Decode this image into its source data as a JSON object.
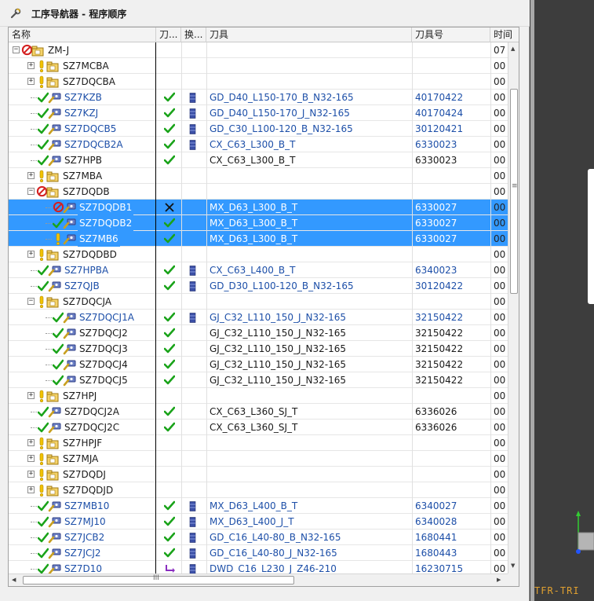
{
  "panel": {
    "title": "工序导航器 - 程序顺序",
    "title_icon": "wrench-icon"
  },
  "columns": {
    "name": "名称",
    "generated": "刀...",
    "changed": "换...",
    "tool": "刀具",
    "tool_number": "刀具号",
    "time": "时间"
  },
  "colors": {
    "selection": "#3399ff",
    "link_blue": "#1d4fa8",
    "check_green": "#1aa31a",
    "warning_yellow": "#f2c200",
    "prohibit_red": "#d42020",
    "viewport_bg": "#3d3d3d",
    "viewport_label": "#e0a030"
  },
  "rows": [
    {
      "name": "ZM-J",
      "level": 0,
      "expander": "-",
      "status": "prohibit",
      "kind": "group",
      "gen": "",
      "chg": "",
      "tool": "",
      "tool_no": "",
      "time": "07",
      "blue": false,
      "selected": false
    },
    {
      "name": "SZ7MCBA",
      "level": 1,
      "expander": "+",
      "status": "warn",
      "kind": "group",
      "gen": "",
      "chg": "",
      "tool": "",
      "tool_no": "",
      "time": "00",
      "blue": false,
      "selected": false
    },
    {
      "name": "SZ7DQCBA",
      "level": 1,
      "expander": "+",
      "status": "warn",
      "kind": "group",
      "gen": "",
      "chg": "",
      "tool": "",
      "tool_no": "",
      "time": "00",
      "blue": false,
      "selected": false
    },
    {
      "name": "SZ7KZB",
      "level": 1,
      "expander": "",
      "status": "ok",
      "kind": "op",
      "gen": "check",
      "chg": "tool",
      "tool": "GD_D40_L150-170_B_N32-165",
      "tool_no": "40170422",
      "time": "00",
      "blue": true,
      "selected": false
    },
    {
      "name": "SZ7KZJ",
      "level": 1,
      "expander": "",
      "status": "ok",
      "kind": "op",
      "gen": "check",
      "chg": "tool",
      "tool": "GD_D40_L150-170_J_N32-165",
      "tool_no": "40170424",
      "time": "00",
      "blue": true,
      "selected": false
    },
    {
      "name": "SZ7DQCB5",
      "level": 1,
      "expander": "",
      "status": "ok",
      "kind": "op",
      "gen": "check",
      "chg": "tool",
      "tool": "GD_C30_L100-120_B_N32-165",
      "tool_no": "30120421",
      "time": "00",
      "blue": true,
      "selected": false
    },
    {
      "name": "SZ7DQCB2A",
      "level": 1,
      "expander": "",
      "status": "ok",
      "kind": "op",
      "gen": "check",
      "chg": "tool",
      "tool": "CX_C63_L300_B_T",
      "tool_no": "6330023",
      "time": "00",
      "blue": true,
      "selected": false
    },
    {
      "name": "SZ7HPB",
      "level": 1,
      "expander": "",
      "status": "ok",
      "kind": "op",
      "gen": "check",
      "chg": "",
      "tool": "CX_C63_L300_B_T",
      "tool_no": "6330023",
      "time": "00",
      "blue": false,
      "selected": false
    },
    {
      "name": "SZ7MBA",
      "level": 1,
      "expander": "+",
      "status": "warn",
      "kind": "group",
      "gen": "",
      "chg": "",
      "tool": "",
      "tool_no": "",
      "time": "00",
      "blue": false,
      "selected": false
    },
    {
      "name": "SZ7DQDB",
      "level": 1,
      "expander": "-",
      "status": "prohibit",
      "kind": "group",
      "gen": "",
      "chg": "",
      "tool": "",
      "tool_no": "",
      "time": "00",
      "blue": false,
      "selected": false
    },
    {
      "name": "SZ7DQDB1",
      "level": 2,
      "expander": "",
      "status": "prohibit",
      "kind": "op",
      "gen": "cross",
      "chg": "",
      "tool": "MX_D63_L300_B_T",
      "tool_no": "6330027",
      "time": "00",
      "blue": false,
      "selected": true
    },
    {
      "name": "SZ7DQDB2",
      "level": 2,
      "expander": "",
      "status": "ok",
      "kind": "op",
      "gen": "check",
      "chg": "",
      "tool": "MX_D63_L300_B_T",
      "tool_no": "6330027",
      "time": "00",
      "blue": false,
      "selected": true
    },
    {
      "name": "SZ7MB6",
      "level": 2,
      "expander": "",
      "status": "warn",
      "kind": "op",
      "gen": "check",
      "chg": "",
      "tool": "MX_D63_L300_B_T",
      "tool_no": "6330027",
      "time": "00",
      "blue": false,
      "selected": true
    },
    {
      "name": "SZ7DQDBD",
      "level": 1,
      "expander": "+",
      "status": "warn",
      "kind": "group",
      "gen": "",
      "chg": "",
      "tool": "",
      "tool_no": "",
      "time": "00",
      "blue": false,
      "selected": false
    },
    {
      "name": "SZ7HPBA",
      "level": 1,
      "expander": "",
      "status": "ok",
      "kind": "op",
      "gen": "check",
      "chg": "tool",
      "tool": "CX_C63_L400_B_T",
      "tool_no": "6340023",
      "time": "00",
      "blue": true,
      "selected": false
    },
    {
      "name": "SZ7QJB",
      "level": 1,
      "expander": "",
      "status": "ok",
      "kind": "op",
      "gen": "check",
      "chg": "tool",
      "tool": "GD_D30_L100-120_B_N32-165",
      "tool_no": "30120422",
      "time": "00",
      "blue": true,
      "selected": false
    },
    {
      "name": "SZ7DQCJA",
      "level": 1,
      "expander": "-",
      "status": "warn",
      "kind": "group",
      "gen": "",
      "chg": "",
      "tool": "",
      "tool_no": "",
      "time": "00",
      "blue": false,
      "selected": false
    },
    {
      "name": "SZ7DQCJ1A",
      "level": 2,
      "expander": "",
      "status": "ok",
      "kind": "op",
      "gen": "check",
      "chg": "tool",
      "tool": "GJ_C32_L110_150_J_N32-165",
      "tool_no": "32150422",
      "time": "00",
      "blue": true,
      "selected": false
    },
    {
      "name": "SZ7DQCJ2",
      "level": 2,
      "expander": "",
      "status": "ok",
      "kind": "op",
      "gen": "check",
      "chg": "",
      "tool": "GJ_C32_L110_150_J_N32-165",
      "tool_no": "32150422",
      "time": "00",
      "blue": false,
      "selected": false
    },
    {
      "name": "SZ7DQCJ3",
      "level": 2,
      "expander": "",
      "status": "ok",
      "kind": "op",
      "gen": "check",
      "chg": "",
      "tool": "GJ_C32_L110_150_J_N32-165",
      "tool_no": "32150422",
      "time": "00",
      "blue": false,
      "selected": false
    },
    {
      "name": "SZ7DQCJ4",
      "level": 2,
      "expander": "",
      "status": "ok",
      "kind": "op",
      "gen": "check",
      "chg": "",
      "tool": "GJ_C32_L110_150_J_N32-165",
      "tool_no": "32150422",
      "time": "00",
      "blue": false,
      "selected": false
    },
    {
      "name": "SZ7DQCJ5",
      "level": 2,
      "expander": "",
      "status": "ok",
      "kind": "op",
      "gen": "check",
      "chg": "",
      "tool": "GJ_C32_L110_150_J_N32-165",
      "tool_no": "32150422",
      "time": "00",
      "blue": false,
      "selected": false
    },
    {
      "name": "SZ7HPJ",
      "level": 1,
      "expander": "+",
      "status": "warn",
      "kind": "group",
      "gen": "",
      "chg": "",
      "tool": "",
      "tool_no": "",
      "time": "00",
      "blue": false,
      "selected": false
    },
    {
      "name": "SZ7DQCJ2A",
      "level": 1,
      "expander": "",
      "status": "ok",
      "kind": "op",
      "gen": "check",
      "chg": "",
      "tool": "CX_C63_L360_SJ_T",
      "tool_no": "6336026",
      "time": "00",
      "blue": false,
      "selected": false
    },
    {
      "name": "SZ7DQCJ2C",
      "level": 1,
      "expander": "",
      "status": "ok",
      "kind": "op",
      "gen": "check",
      "chg": "",
      "tool": "CX_C63_L360_SJ_T",
      "tool_no": "6336026",
      "time": "00",
      "blue": false,
      "selected": false
    },
    {
      "name": "SZ7HPJF",
      "level": 1,
      "expander": "+",
      "status": "warn",
      "kind": "group",
      "gen": "",
      "chg": "",
      "tool": "",
      "tool_no": "",
      "time": "00",
      "blue": false,
      "selected": false
    },
    {
      "name": "SZ7MJA",
      "level": 1,
      "expander": "+",
      "status": "warn",
      "kind": "group",
      "gen": "",
      "chg": "",
      "tool": "",
      "tool_no": "",
      "time": "00",
      "blue": false,
      "selected": false
    },
    {
      "name": "SZ7DQDJ",
      "level": 1,
      "expander": "+",
      "status": "warn",
      "kind": "group",
      "gen": "",
      "chg": "",
      "tool": "",
      "tool_no": "",
      "time": "00",
      "blue": false,
      "selected": false
    },
    {
      "name": "SZ7DQDJD",
      "level": 1,
      "expander": "+",
      "status": "warn",
      "kind": "group",
      "gen": "",
      "chg": "",
      "tool": "",
      "tool_no": "",
      "time": "00",
      "blue": false,
      "selected": false
    },
    {
      "name": "SZ7MB10",
      "level": 1,
      "expander": "",
      "status": "ok",
      "kind": "op",
      "gen": "check",
      "chg": "tool",
      "tool": "MX_D63_L400_B_T",
      "tool_no": "6340027",
      "time": "00",
      "blue": true,
      "selected": false
    },
    {
      "name": "SZ7MJ10",
      "level": 1,
      "expander": "",
      "status": "ok",
      "kind": "op",
      "gen": "check",
      "chg": "tool",
      "tool": "MX_D63_L400_J_T",
      "tool_no": "6340028",
      "time": "00",
      "blue": true,
      "selected": false
    },
    {
      "name": "SZ7JCB2",
      "level": 1,
      "expander": "",
      "status": "ok",
      "kind": "op",
      "gen": "check",
      "chg": "tool",
      "tool": "GD_C16_L40-80_B_N32-165",
      "tool_no": "1680441",
      "time": "00",
      "blue": true,
      "selected": false
    },
    {
      "name": "SZ7JCJ2",
      "level": 1,
      "expander": "",
      "status": "ok",
      "kind": "op",
      "gen": "check",
      "chg": "tool",
      "tool": "GD_C16_L40-80_J_N32-165",
      "tool_no": "1680443",
      "time": "00",
      "blue": true,
      "selected": false
    },
    {
      "name": "SZ7D10",
      "level": 1,
      "expander": "",
      "status": "ok",
      "kind": "op",
      "gen": "arrow",
      "chg": "tool",
      "tool": "DWD_C16_L230_J_Z46-210",
      "tool_no": "16230715",
      "time": "00",
      "blue": true,
      "selected": false
    }
  ],
  "scrollbars": {
    "h_thumb_grip": "III",
    "v_thumb_grip": "≡"
  },
  "viewport": {
    "label": "TFR-TRI"
  }
}
